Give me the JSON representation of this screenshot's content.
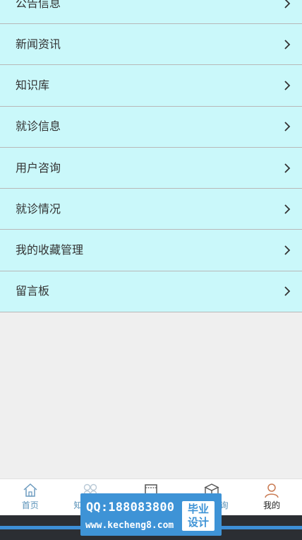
{
  "menu": {
    "items": [
      {
        "label": "公告信息"
      },
      {
        "label": "新闻资讯"
      },
      {
        "label": "知识库"
      },
      {
        "label": "就诊信息"
      },
      {
        "label": "用户咨询"
      },
      {
        "label": "就诊情况"
      },
      {
        "label": "我的收藏管理"
      },
      {
        "label": "留言板"
      }
    ]
  },
  "tabbar": {
    "tabs": [
      {
        "label": "首页",
        "icon": "home-icon"
      },
      {
        "label": "知",
        "icon": "grid-icon"
      },
      {
        "label": "",
        "icon": "document-icon"
      },
      {
        "label": "询",
        "icon": "box-icon"
      },
      {
        "label": "我的",
        "icon": "user-icon"
      }
    ],
    "active_color": "#222222",
    "inactive_color": "#5a92b8"
  },
  "watermark": {
    "qq": "QQ:188083800",
    "site": "www.kecheng8.com",
    "badge_line1": "毕业",
    "badge_line2": "设计"
  },
  "colors": {
    "menu_background": "#caf8fa",
    "page_background": "#efefef",
    "watermark_background": "#3e93d6"
  }
}
